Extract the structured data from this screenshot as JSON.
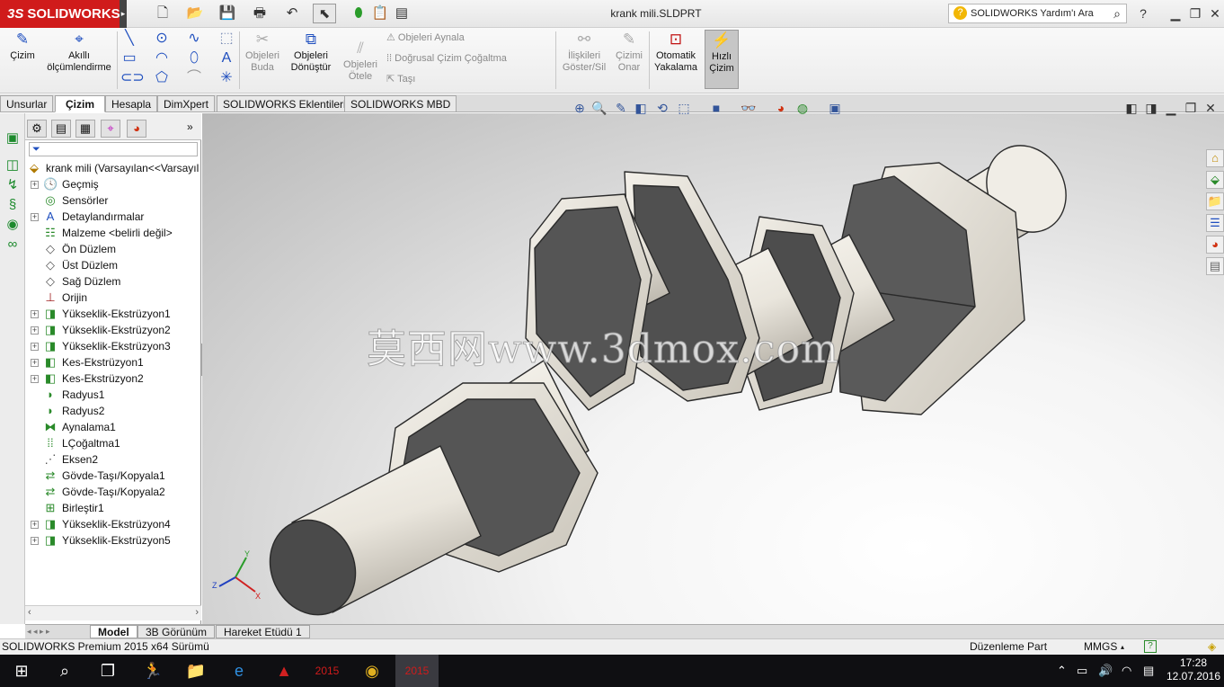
{
  "app": {
    "brand": "SOLIDWORKS",
    "brand_prefix": "3S",
    "document_title": "krank mili.SLDPRT"
  },
  "help_search": {
    "placeholder": "SOLIDWORKS Yardım'ı Ara"
  },
  "ribbon": {
    "cizim": "Çizim",
    "akilli": "Akıllı ölçümlendirme",
    "buda": "Objeleri Buda",
    "donustur": "Objeleri Dönüştür",
    "otele": "Objeleri Ötele",
    "aynala": "Objeleri Aynala",
    "cogaltma": "Doğrusal Çizim Çoğaltma",
    "tasi": "Taşı",
    "iliskiler": "İlişkileri Göster/Sil",
    "onar": "Çizimi Onar",
    "yakalama": "Otomatik Yakalama",
    "hizli": "Hızlı Çizim"
  },
  "tabs": [
    "Unsurlar",
    "Çizim",
    "Hesapla",
    "DimXpert",
    "SOLIDWORKS Eklentileri",
    "SOLIDWORKS MBD"
  ],
  "active_tab": "Çizim",
  "tree": {
    "root": "krank mili  (Varsayılan<<Varsayıl",
    "items": [
      {
        "label": "Geçmiş",
        "icon": "history-icon",
        "expand": true
      },
      {
        "label": "Sensörler",
        "icon": "sensor-icon",
        "expand": false
      },
      {
        "label": "Detaylandırmalar",
        "icon": "annotation-icon",
        "expand": true
      },
      {
        "label": "Malzeme <belirli değil>",
        "icon": "material-icon",
        "expand": false
      },
      {
        "label": "Ön Düzlem",
        "icon": "plane-icon",
        "expand": false
      },
      {
        "label": "Üst Düzlem",
        "icon": "plane-icon",
        "expand": false
      },
      {
        "label": "Sağ Düzlem",
        "icon": "plane-icon",
        "expand": false
      },
      {
        "label": "Orijin",
        "icon": "origin-icon",
        "expand": false
      },
      {
        "label": "Yükseklik-Ekstrüzyon1",
        "icon": "extrude-icon",
        "expand": true
      },
      {
        "label": "Yükseklik-Ekstrüzyon2",
        "icon": "extrude-icon",
        "expand": true
      },
      {
        "label": "Yükseklik-Ekstrüzyon3",
        "icon": "extrude-icon",
        "expand": true
      },
      {
        "label": "Kes-Ekstrüzyon1",
        "icon": "cut-extrude-icon",
        "expand": true
      },
      {
        "label": "Kes-Ekstrüzyon2",
        "icon": "cut-extrude-icon",
        "expand": true
      },
      {
        "label": "Radyus1",
        "icon": "fillet-icon",
        "expand": false
      },
      {
        "label": "Radyus2",
        "icon": "fillet-icon",
        "expand": false
      },
      {
        "label": "Aynalama1",
        "icon": "mirror-icon",
        "expand": false
      },
      {
        "label": "LÇoğaltma1",
        "icon": "pattern-icon",
        "expand": false
      },
      {
        "label": "Eksen2",
        "icon": "axis-icon",
        "expand": false
      },
      {
        "label": "Gövde-Taşı/Kopyala1",
        "icon": "move-body-icon",
        "expand": false
      },
      {
        "label": "Gövde-Taşı/Kopyala2",
        "icon": "move-body-icon",
        "expand": false
      },
      {
        "label": "Birleştir1",
        "icon": "combine-icon",
        "expand": false
      },
      {
        "label": "Yükseklik-Ekstrüzyon4",
        "icon": "extrude-icon",
        "expand": true
      },
      {
        "label": "Yükseklik-Ekstrüzyon5",
        "icon": "extrude-icon",
        "expand": true
      }
    ]
  },
  "watermark": "莫西网www.3dmox.com",
  "triad": {
    "x": "X",
    "y": "Y",
    "z": "Z"
  },
  "bottom_tabs": [
    "Model",
    "3B Görünüm",
    "Hareket Etüdü 1"
  ],
  "status": {
    "version": "SOLIDWORKS Premium 2015 x64 Sürümü",
    "mode": "Düzenleme Part",
    "units": "MMGS"
  },
  "taskbar": {
    "time": "17:28",
    "date": "12.07.2016",
    "sw_badge": "2015"
  },
  "colors": {
    "brand_red": "#d01b1b",
    "part_shade": "#ece8df",
    "taskbar": "#0f0f12"
  }
}
